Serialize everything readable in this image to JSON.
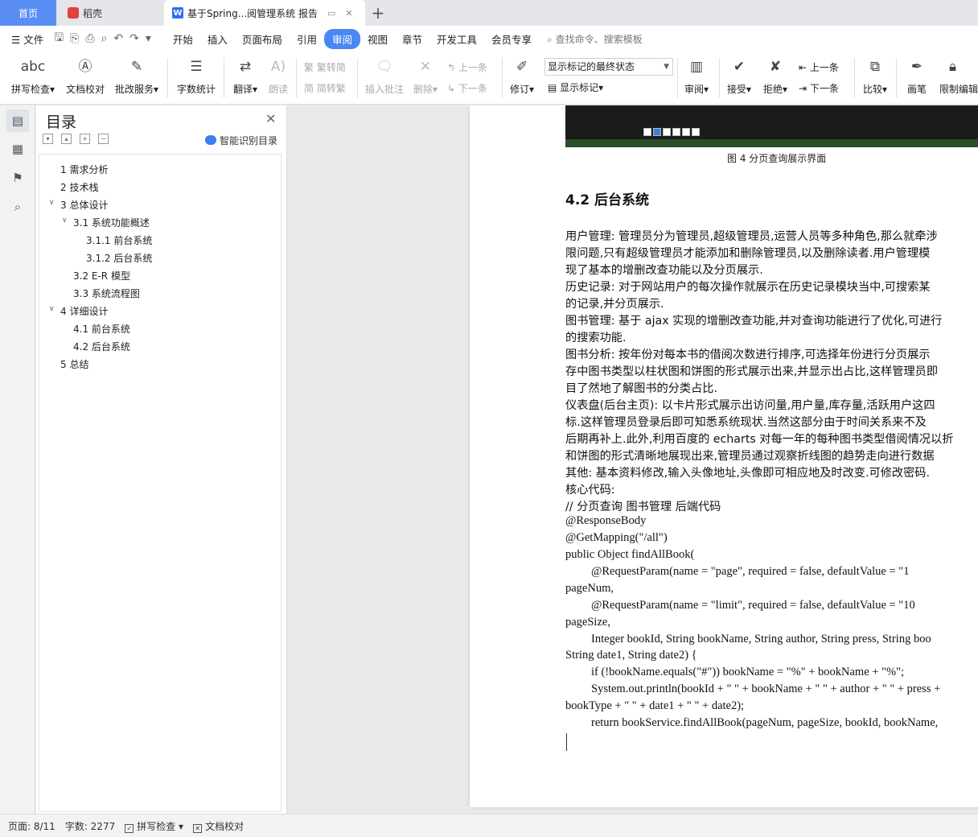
{
  "tabs": {
    "home": "首页",
    "daoke": "稻壳",
    "doc": "基于Spring...阅管理系统 报告"
  },
  "menu": {
    "file": "文件",
    "items": [
      "开始",
      "插入",
      "页面布局",
      "引用",
      "审阅",
      "视图",
      "章节",
      "开发工具",
      "会员专享"
    ],
    "active_index": 4,
    "search": "查找命令、搜索模板"
  },
  "ribbon": {
    "spell": "拼写检查",
    "proofread": "文档校对",
    "review_service": "批改服务",
    "word_count": "字数统计",
    "translate": "翻译",
    "read_aloud": "朗读",
    "trad": "繁转简",
    "simp": "简转繁",
    "insert_comment": "插入批注",
    "delete": "删除",
    "prev_comment": "上一条",
    "next_comment": "下一条",
    "track": "修订",
    "markup_select": "显示标记的最终状态",
    "show_markup": "显示标记",
    "review": "审阅",
    "accept": "接受",
    "reject": "拒绝",
    "prev": "上一条",
    "next": "下一条",
    "compare": "比较",
    "pen": "画笔",
    "restrict": "限制编辑"
  },
  "toc": {
    "title": "目录",
    "smart": "智能识别目录",
    "items": [
      "1 需求分析",
      "2 技术栈",
      "3 总体设计",
      "3.1 系统功能概述",
      "3.1.1 前台系统",
      "3.1.2 后台系统",
      "3.2 E-R 模型",
      "3.3 系统流程图",
      "4 详细设计",
      "4.1 前台系统",
      "4.2 后台系统",
      "5 总结"
    ]
  },
  "document": {
    "figure_caption": "图 4 分页查询展示界面",
    "heading": "4.2 后台系统",
    "paragraphs": [
      "用户管理: 管理员分为管理员,超级管理员,运营人员等多种角色,那么就牵涉",
      "限问题,只有超级管理员才能添加和删除管理员,以及删除读者.用户管理模",
      "现了基本的增删改查功能以及分页展示.",
      "历史记录: 对于网站用户的每次操作就展示在历史记录模块当中,可搜索某",
      "的记录,并分页展示.",
      "图书管理: 基于 ajax 实现的增删改查功能,并对查询功能进行了优化,可进行",
      "的搜索功能.",
      "图书分析: 按年份对每本书的借阅次数进行排序,可选择年份进行分页展示",
      "存中图书类型以柱状图和饼图的形式展示出来,并显示出占比,这样管理员即",
      "目了然地了解图书的分类占比.",
      "仪表盘(后台主页): 以卡片形式展示出访问量,用户量,库存量,活跃用户这四",
      "标.这样管理员登录后即可知悉系统现状.当然这部分由于时间关系来不及",
      "后期再补上.此外,利用百度的 echarts 对每一年的每种图书类型借阅情况以折",
      "和饼图的形式清晰地展现出来,管理员通过观察折线图的趋势走向进行数据",
      "其他: 基本资料修改,输入头像地址,头像即可相应地及时改变.可修改密码.",
      "核心代码:",
      "// 分页查询 图书管理 后端代码"
    ],
    "code": [
      "@ResponseBody",
      "@GetMapping(\"/all\")",
      "public Object findAllBook(",
      "@RequestParam(name = \"page\", required = false, defaultValue = \"1",
      "pageNum,",
      "@RequestParam(name = \"limit\", required = false, defaultValue = \"10",
      "pageSize,",
      "Integer bookId, String bookName, String author, String press, String boo",
      "String date1, String date2) {",
      "if (!bookName.equals(\"#\")) bookName = \"%\" + bookName + \"%\";",
      "System.out.println(bookId + \" \" + bookName + \" \" + author + \" \" + press +",
      "bookType + \" \" + date1 + \" \" + date2);",
      "return bookService.findAllBook(pageNum, pageSize, bookId, bookName,"
    ]
  },
  "status": {
    "page": "页面: 8/11",
    "words": "字数: 2277",
    "spell": "拼写检查",
    "proof": "文档校对"
  }
}
